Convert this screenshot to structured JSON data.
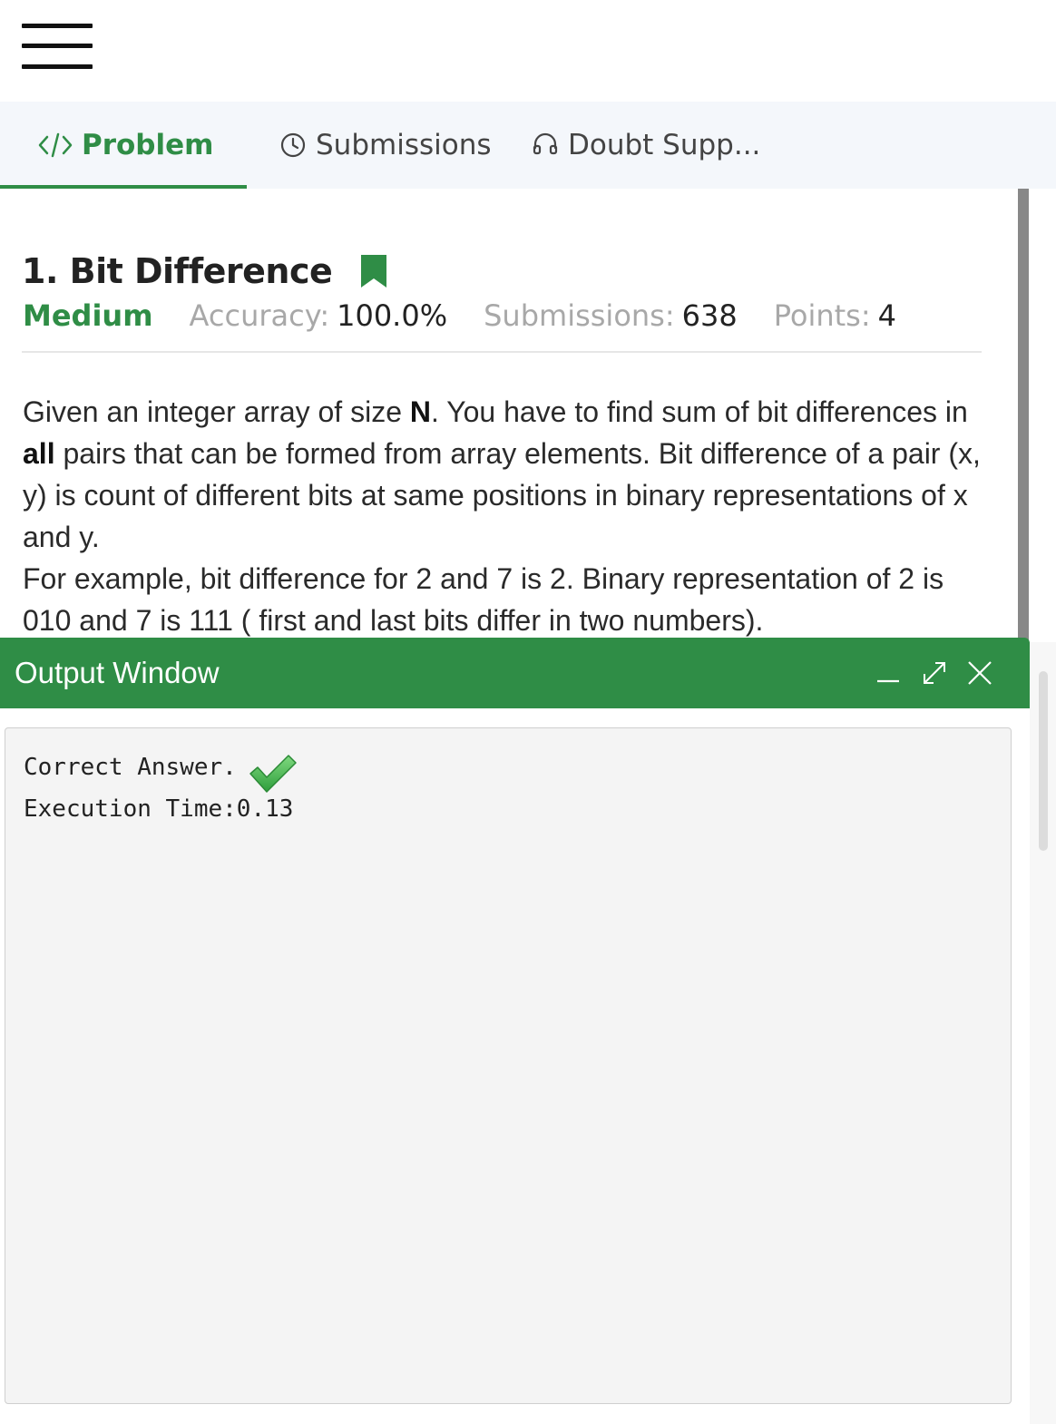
{
  "tabs": {
    "problem": "Problem",
    "submissions": "Submissions",
    "doubt": "Doubt Supp..."
  },
  "problem": {
    "title": "1. Bit Difference",
    "difficulty": "Medium",
    "accuracy_label": "Accuracy:",
    "accuracy_value": "100.0%",
    "submissions_label": "Submissions:",
    "submissions_value": "638",
    "points_label": "Points:",
    "points_value": "4",
    "desc": {
      "p1_a": "Given an integer array of size ",
      "p1_n": "N",
      "p1_b": ". You have to find sum of bit differences in ",
      "p1_all": "all",
      "p1_c": " pairs that can be formed from array elements. Bit difference of a pair (x, y) is count of different bits at same positions in binary representations of x and y.",
      "p2": "For example, bit difference for 2 and 7 is 2. Binary representation of 2 is 010 and 7 is 111 ( first and last bits differ in two numbers)."
    }
  },
  "output_window": {
    "title": "Output Window",
    "line1": "Correct Answer.",
    "line2": "Execution Time:0.13"
  },
  "colors": {
    "brand_green": "#2f8d46",
    "check_green": "#3cb54a"
  },
  "icons": {
    "menu": "hamburger-menu-icon",
    "problem": "code-icon",
    "submissions": "clock-icon",
    "doubt": "headset-icon",
    "bookmark": "bookmark-icon",
    "minimize": "minimize-icon",
    "maximize": "expand-icon",
    "close": "close-icon",
    "status": "checkmark-icon"
  }
}
